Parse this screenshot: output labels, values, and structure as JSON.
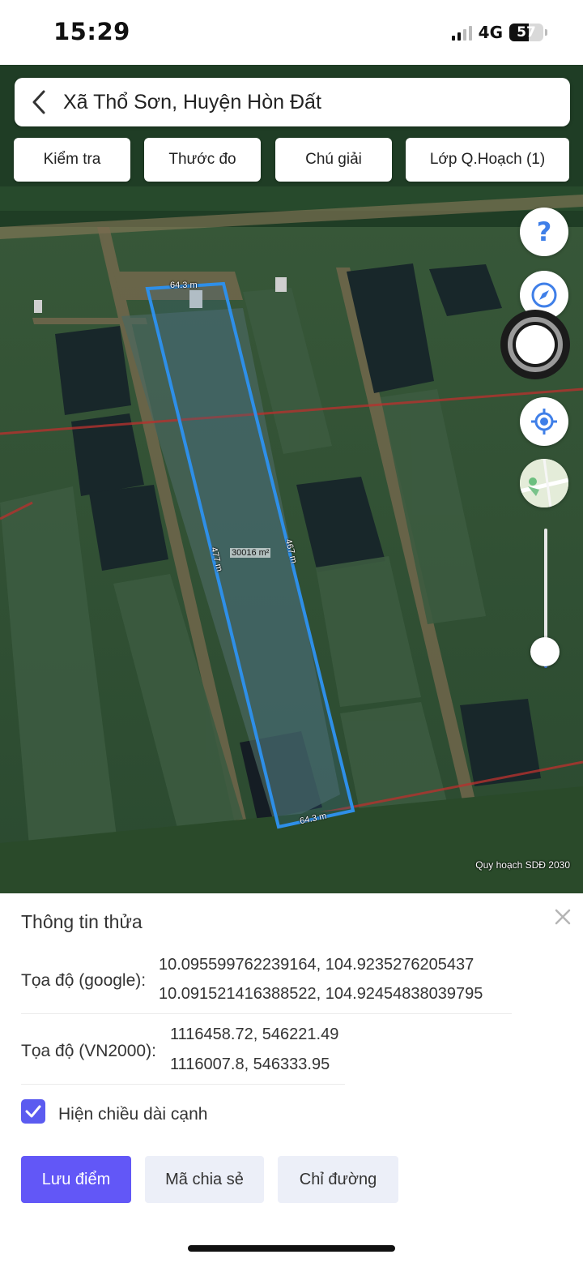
{
  "status_bar": {
    "time": "15:29",
    "network": "4G",
    "battery": "57",
    "battery_level_percent": 57
  },
  "search": {
    "location_text": "Xã Thổ Sơn, Huyện Hòn Đất",
    "back_icon": "chevron-left-icon"
  },
  "toolbar": {
    "check_label": "Kiểm tra",
    "measure_label": "Thước đo",
    "legend_label": "Chú giải",
    "layer_label": "Lớp Q.Hoạch (1)"
  },
  "map_controls": {
    "help_icon": "question-mark-icon",
    "compass_icon": "compass-icon",
    "record_icon": "record-icon",
    "locate_icon": "crosshair-icon",
    "layers_icon": "map-thumbnail-icon",
    "zoom_level_fraction": 0.15
  },
  "parcel": {
    "top_edge": "64.3 m",
    "bottom_edge": "64.3 m",
    "left_edge": "477 m",
    "right_edge": "467 m",
    "area": "30016 m²",
    "outline_color": "#2e8fe8"
  },
  "map_credit": "Quy hoạch SDĐ 2030",
  "sheet": {
    "title": "Thông tin thửa",
    "close_icon": "close-icon",
    "google_label": "Tọa độ (google):",
    "google_coord_1": "10.095599762239164, 104.9235276205437",
    "google_coord_2": "10.091521416388522, 104.92454838039795",
    "vn2000_label": "Tọa độ (VN2000):",
    "vn2000_coord_1": "1116458.72, 546221.49",
    "vn2000_coord_2": "1116007.8, 546333.95",
    "show_edges_label": "Hiện chiều dài cạnh",
    "show_edges_checked": true,
    "save_label": "Lưu điểm",
    "share_label": "Mã chia sẻ",
    "directions_label": "Chỉ đường"
  },
  "colors": {
    "accent": "#6257f7",
    "secondary_button": "#eceff8",
    "locate_blue": "#3f7fe8"
  }
}
